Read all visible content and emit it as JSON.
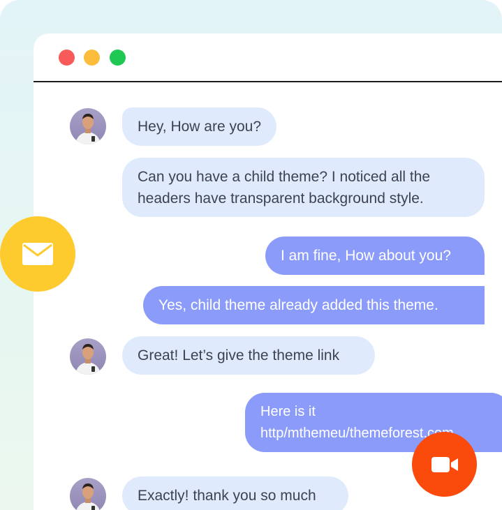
{
  "window": {
    "controls": [
      "close",
      "minimize",
      "maximize"
    ]
  },
  "messages": [
    {
      "side": "in",
      "text": "Hey, How are you?"
    },
    {
      "side": "in",
      "lines": [
        "Can you have a child theme? I noticed all the",
        "headers have transparent background style."
      ]
    },
    {
      "side": "out",
      "text": "I am fine, How about you?"
    },
    {
      "side": "out",
      "text": "Yes, child theme already added this theme."
    },
    {
      "side": "in",
      "text": "Great! Let’s give the theme link"
    },
    {
      "side": "out",
      "lines": [
        "Here is it",
        "http/mthemeu/themeforest.com"
      ]
    },
    {
      "side": "in",
      "text": "Exactly! thank you so much"
    }
  ],
  "floating": {
    "mail_icon": "envelope-icon",
    "video_icon": "video-camera-icon"
  },
  "colors": {
    "incoming_bubble": "#dfebfd",
    "outgoing_bubble": "#8b9bf9",
    "mail_button": "#fecb2f",
    "video_button": "#fa4a0c",
    "close_dot": "#f85a5a",
    "minimize_dot": "#fcbd3c",
    "maximize_dot": "#1ec852"
  }
}
